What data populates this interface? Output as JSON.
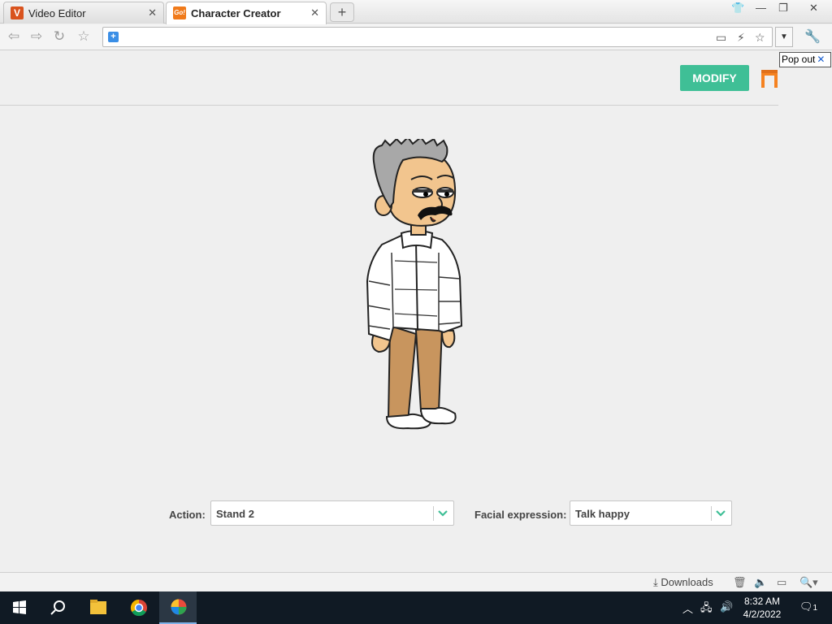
{
  "browser": {
    "tabs": [
      {
        "title": "Video Editor",
        "favicon": "V",
        "favicon_color": "#d9531e"
      },
      {
        "title": "Character Creator",
        "favicon": "Go!",
        "favicon_color": "#f07a1a"
      }
    ],
    "new_tab_label": "+",
    "address_value": "",
    "tab_close": "✕"
  },
  "page": {
    "popout_label": "Pop out",
    "popout_close": "✕",
    "modify_label": "MODIFY",
    "accent_color": "#3fbf96",
    "action_label": "Action:",
    "action_value": "Stand 2",
    "expression_label": "Facial expression:",
    "expression_value": "Talk happy"
  },
  "statusbar": {
    "downloads_label": "Downloads"
  },
  "taskbar": {
    "time": "8:32 AM",
    "date": "4/2/2022",
    "notification_count": "1"
  }
}
